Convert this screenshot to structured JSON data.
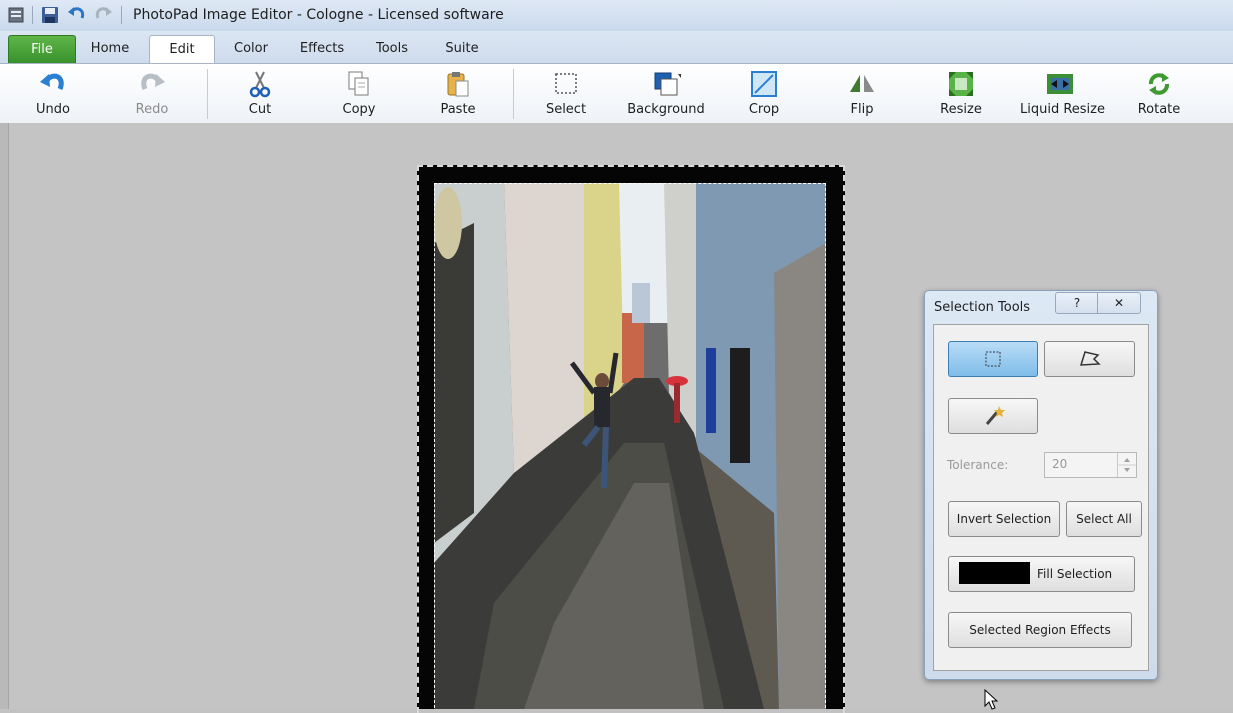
{
  "window": {
    "title": "PhotoPad Image Editor - Cologne - Licensed software"
  },
  "quick_access": {
    "items": [
      "menu-icon",
      "save-icon",
      "undo-icon",
      "redo-icon"
    ]
  },
  "tabs": [
    {
      "label": "File"
    },
    {
      "label": "Home"
    },
    {
      "label": "Edit"
    },
    {
      "label": "Color"
    },
    {
      "label": "Effects"
    },
    {
      "label": "Tools"
    },
    {
      "label": "Suite"
    }
  ],
  "active_tab": "Edit",
  "ribbon": {
    "undo": "Undo",
    "redo": "Redo",
    "cut": "Cut",
    "copy": "Copy",
    "paste": "Paste",
    "select": "Select",
    "background": "Background",
    "crop": "Crop",
    "flip": "Flip",
    "resize": "Resize",
    "liquid_resize": "Liquid Resize",
    "rotate": "Rotate"
  },
  "selection_tools": {
    "title": "Selection Tools",
    "help_label": "?",
    "close_label": "✕",
    "tolerance_label": "Tolerance:",
    "tolerance_value": "20",
    "invert_selection": "Invert Selection",
    "select_all": "Select All",
    "fill_selection": "Fill Selection",
    "fill_color": "#000000",
    "selected_region_effects": "Selected Region Effects"
  },
  "colors": {
    "file_tab": "#3f9a31",
    "workspace": "#c4c4c4",
    "ribbon_icon_blue": "#2b7fd0"
  }
}
